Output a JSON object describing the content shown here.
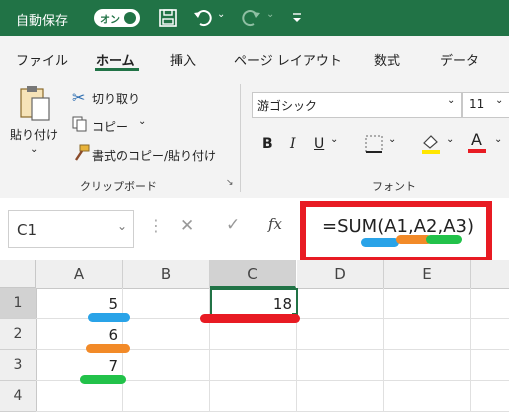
{
  "titlebar": {
    "autosave_label": "自動保存",
    "toggle_label": "オン"
  },
  "tabs": [
    "ファイル",
    "ホーム",
    "挿入",
    "ページ レイアウト",
    "数式",
    "データ"
  ],
  "clipboard": {
    "paste_label": "貼り付け",
    "cut_label": "切り取り",
    "copy_label": "コピー",
    "format_painter_label": "書式のコピー/貼り付け",
    "group_label": "クリップボード"
  },
  "font": {
    "name": "游ゴシック",
    "size": "11",
    "group_label": "フォント"
  },
  "formula_bar": {
    "name_box": "C1",
    "formula": "=SUM(A1,A2,A3)"
  },
  "grid": {
    "columns": [
      "A",
      "B",
      "C",
      "D",
      "E"
    ],
    "rows": [
      "1",
      "2",
      "3",
      "4"
    ],
    "values": {
      "A1": "5",
      "A2": "6",
      "A3": "7",
      "C1": "18"
    }
  },
  "colors": {
    "title_green": "#217346",
    "highlight_red": "#e81b23",
    "blue": "#29a3e8",
    "orange": "#f28a28",
    "green": "#22c24a"
  }
}
